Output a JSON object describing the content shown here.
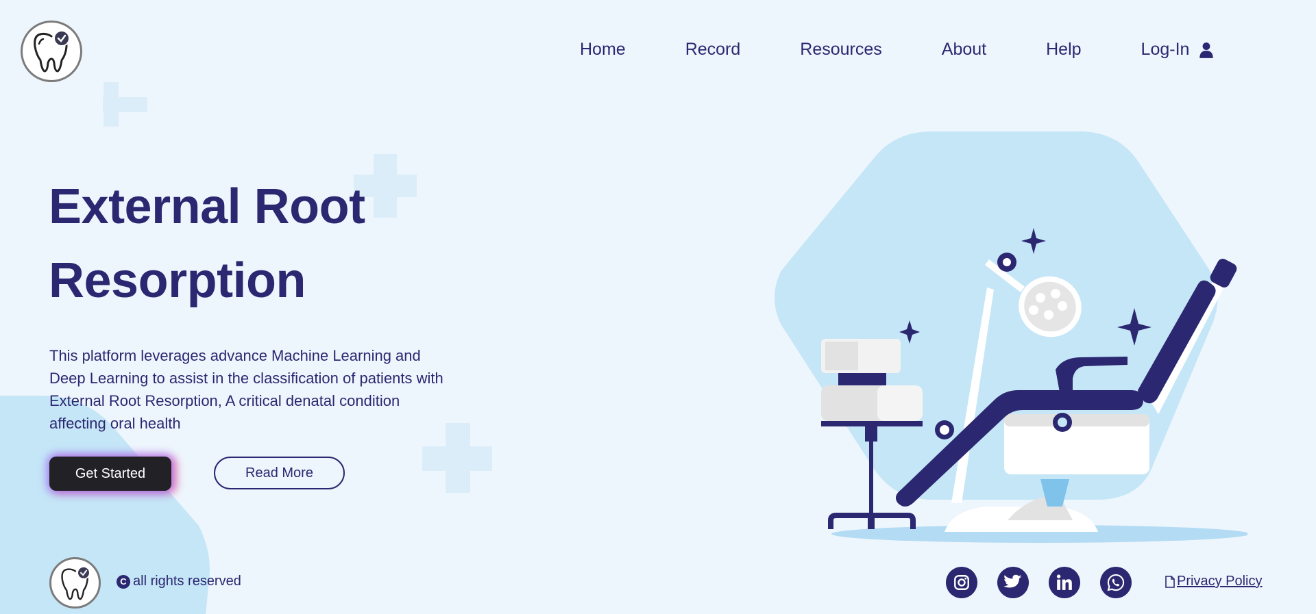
{
  "nav": {
    "items": [
      {
        "label": "Home"
      },
      {
        "label": "Record"
      },
      {
        "label": "Resources"
      },
      {
        "label": "About"
      },
      {
        "label": "Help"
      }
    ],
    "login_label": "Log-In"
  },
  "hero": {
    "title_line1": "External Root",
    "title_line2": "Resorption",
    "description": "This platform leverages advance Machine Learning and Deep Learning to assist in the classification of patients with External Root Resorption, A critical denatal condition affecting oral health",
    "primary_button": "Get Started",
    "secondary_button": "Read More"
  },
  "footer": {
    "copyright": "all rights reserved",
    "copyright_symbol": "C",
    "socials": [
      "instagram-icon",
      "twitter-icon",
      "linkedin-icon",
      "whatsapp-icon"
    ],
    "privacy_label": "Privacy Policy"
  },
  "colors": {
    "navy": "#2b2770",
    "background": "#eef6fd",
    "light_blue": "#c5e6f7",
    "button_dark": "#222126"
  }
}
